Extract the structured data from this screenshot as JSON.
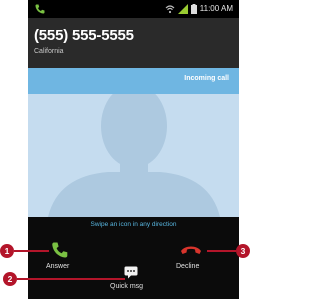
{
  "status_bar": {
    "time": "11:00 AM",
    "icons": [
      "call-active-icon",
      "wifi-icon",
      "signal-icon",
      "battery-icon"
    ]
  },
  "caller": {
    "number": "(555) 555-5555",
    "location": "California"
  },
  "incoming_label": "Incoming call",
  "hint": "Swipe an icon in any direction",
  "actions": {
    "answer_label": "Answer",
    "decline_label": "Decline",
    "quick_msg_label": "Quick msg"
  },
  "callouts": [
    "1",
    "2",
    "3"
  ],
  "colors": {
    "answer_green": "#7ac143",
    "decline_red": "#d8342c",
    "incoming_blue": "#6fb6e2",
    "hint_blue": "#58b6e0",
    "callout_red": "#b3152a"
  }
}
